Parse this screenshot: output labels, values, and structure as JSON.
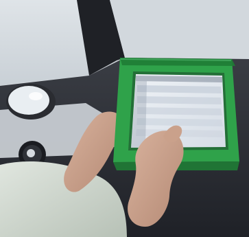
{
  "scene": {
    "subject": "person-using-green-diagnostic-tablet-in-vehicle",
    "colors": {
      "tablet_frame": "#2fa24a",
      "tablet_frame_dark": "#1f7c35",
      "screen_bg": "#e7ebf1",
      "interior_dark": "#2b2d33",
      "window_light": "#cfd5db",
      "shirt": "#cfd8cf",
      "skin": "#c9a18a"
    },
    "icons": [
      "mirror-icon",
      "air-vent-icon"
    ]
  }
}
